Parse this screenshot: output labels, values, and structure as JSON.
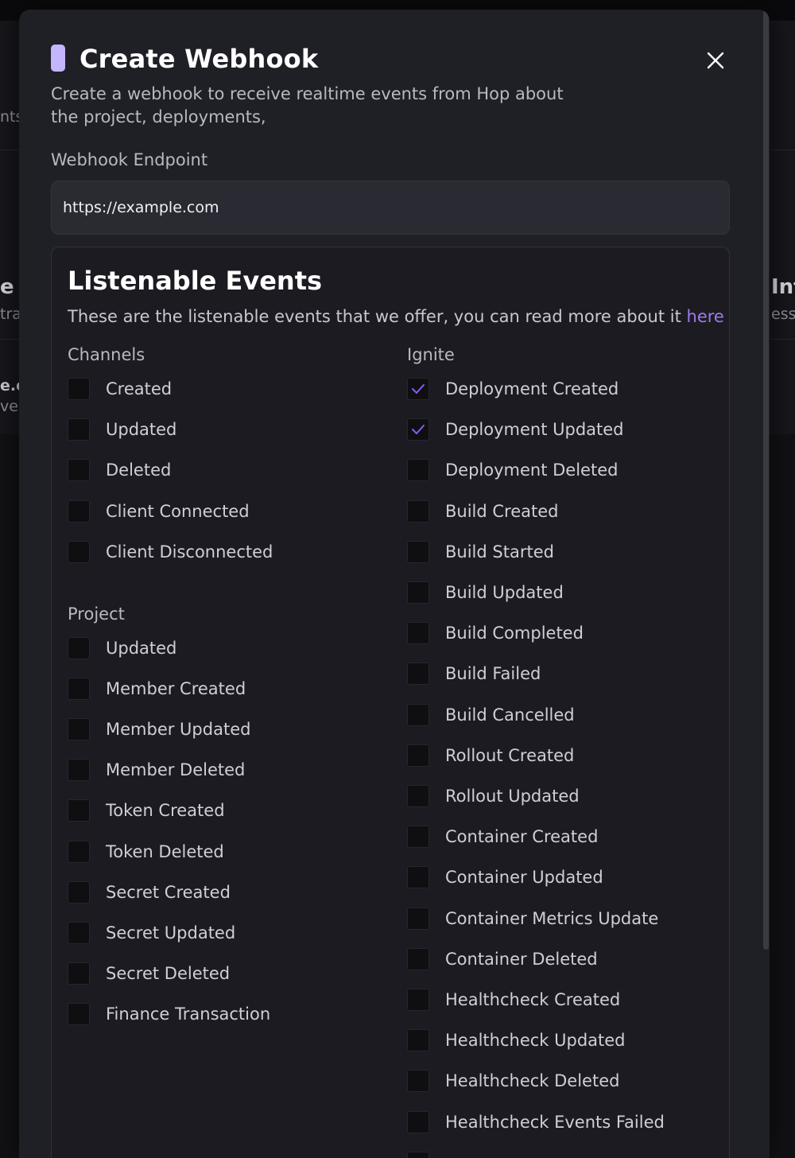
{
  "background": {
    "left_fragments": [
      "nts",
      "e",
      "tra",
      "e.c",
      "ven"
    ],
    "right_fragments": [
      "Int",
      "ess"
    ]
  },
  "modal": {
    "title": "Create Webhook",
    "subtitle": "Create a webhook to receive realtime events from Hop about the project, deployments,",
    "close_icon": "close-icon",
    "accent_color": "#c4b5fd",
    "endpoint": {
      "label": "Webhook Endpoint",
      "value": "https://example.com",
      "placeholder": ""
    },
    "events": {
      "title": "Listenable Events",
      "description": "These are the listenable events that we offer, you can read more about it",
      "link_label": "here",
      "link_color": "#9f7aea",
      "check_color": "#8b5cf6",
      "groups": [
        {
          "name": "Channels",
          "items": [
            {
              "label": "Created",
              "checked": false
            },
            {
              "label": "Updated",
              "checked": false
            },
            {
              "label": "Deleted",
              "checked": false
            },
            {
              "label": "Client Connected",
              "checked": false
            },
            {
              "label": "Client Disconnected",
              "checked": false
            }
          ]
        },
        {
          "name": "Project",
          "items": [
            {
              "label": "Updated",
              "checked": false
            },
            {
              "label": "Member Created",
              "checked": false
            },
            {
              "label": "Member Updated",
              "checked": false
            },
            {
              "label": "Member Deleted",
              "checked": false
            },
            {
              "label": "Token Created",
              "checked": false
            },
            {
              "label": "Token Deleted",
              "checked": false
            },
            {
              "label": "Secret Created",
              "checked": false
            },
            {
              "label": "Secret Updated",
              "checked": false
            },
            {
              "label": "Secret Deleted",
              "checked": false
            },
            {
              "label": "Finance Transaction",
              "checked": false
            }
          ]
        },
        {
          "name": "Ignite",
          "items": [
            {
              "label": "Deployment Created",
              "checked": true
            },
            {
              "label": "Deployment Updated",
              "checked": true
            },
            {
              "label": "Deployment Deleted",
              "checked": false
            },
            {
              "label": "Build Created",
              "checked": false
            },
            {
              "label": "Build Started",
              "checked": false
            },
            {
              "label": "Build Updated",
              "checked": false
            },
            {
              "label": "Build Completed",
              "checked": false
            },
            {
              "label": "Build Failed",
              "checked": false
            },
            {
              "label": "Build Cancelled",
              "checked": false
            },
            {
              "label": "Rollout Created",
              "checked": false
            },
            {
              "label": "Rollout Updated",
              "checked": false
            },
            {
              "label": "Container Created",
              "checked": false
            },
            {
              "label": "Container Updated",
              "checked": false
            },
            {
              "label": "Container Metrics Update",
              "checked": false
            },
            {
              "label": "Container Deleted",
              "checked": false
            },
            {
              "label": "Healthcheck Created",
              "checked": false
            },
            {
              "label": "Healthcheck Updated",
              "checked": false
            },
            {
              "label": "Healthcheck Deleted",
              "checked": false
            },
            {
              "label": "Healthcheck Events Failed",
              "checked": false
            },
            {
              "label": "",
              "checked": false
            }
          ]
        }
      ]
    }
  }
}
